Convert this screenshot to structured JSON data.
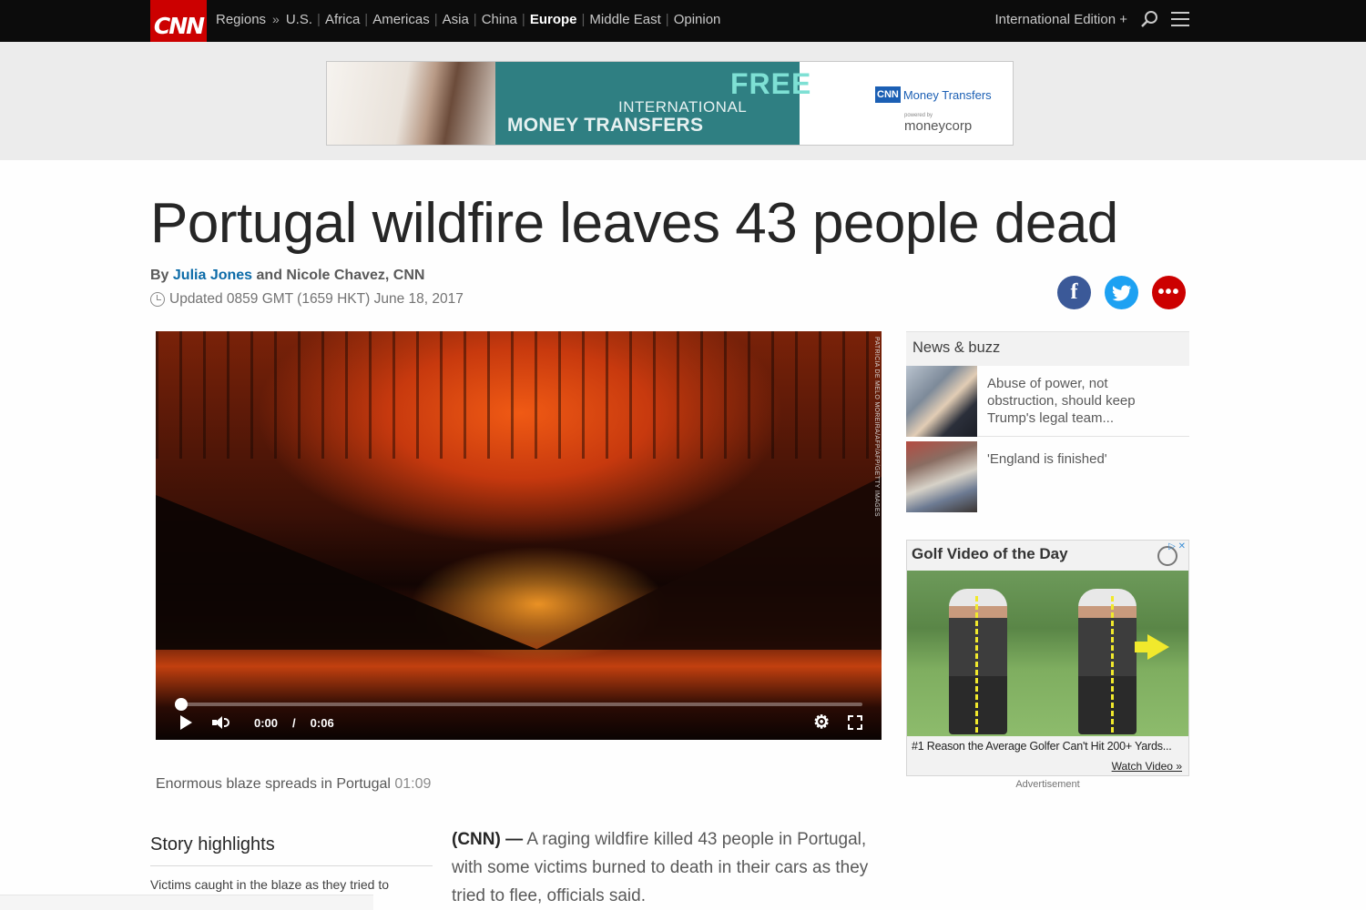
{
  "nav": {
    "logo": "CNN",
    "regions": "Regions",
    "raquo": "»",
    "items": [
      "U.S.",
      "Africa",
      "Americas",
      "Asia",
      "China",
      "Europe",
      "Middle East",
      "Opinion"
    ],
    "active": "Europe",
    "edition": "International Edition +",
    "search_icon": "search-icon",
    "menu_icon": "hamburger-menu-icon"
  },
  "banner_ad": {
    "free": "FREE",
    "international": "INTERNATIONAL",
    "money_transfers": "MONEY TRANSFERS",
    "brand_box": "CNN",
    "brand_text": "Money Transfers",
    "powered": "powered by",
    "partner": "moneycorp"
  },
  "article": {
    "headline": "Portugal wildfire leaves 43 people dead",
    "by": "By",
    "author_link": "Julia Jones",
    "coauthors": "and Nicole Chavez, CNN",
    "updated": "Updated 0859 GMT (1659 HKT) June 18, 2017",
    "share": {
      "facebook": "f",
      "twitter": "t",
      "more": "•••"
    }
  },
  "video": {
    "credit": "PATRICIA DE MELO MOREIRA/AFP/AFP/GETTY IMAGES",
    "current_time": "0:00",
    "separator": "/",
    "duration": "0:06",
    "progress": 0,
    "caption": "Enormous blaze spreads in Portugal",
    "caption_duration": "01:09"
  },
  "highlights": {
    "title": "Story highlights",
    "items": [
      "Victims caught in the blaze as they tried to"
    ]
  },
  "body": {
    "dateline": "(CNN) —",
    "text": " A raging wildfire killed 43 people in Portugal, with some victims burned to death in their cars as they tried to flee, officials said."
  },
  "sidebar": {
    "news_buzz_title": "News & buzz",
    "items": [
      {
        "text": "Abuse of power, not obstruction, should keep Trump's legal team..."
      },
      {
        "text": "'England is finished'"
      }
    ],
    "golf_ad": {
      "title": "Golf Video of the Day",
      "ad_choices": "▷ ✕",
      "reason": "#1 Reason the Average Golfer Can't Hit 200+ Yards...",
      "watch": "Watch Video »"
    },
    "ad_label": "Advertisement"
  },
  "colors": {
    "cnn_red": "#cc0000",
    "nav_bg": "#0c0c0c",
    "link_blue": "#0c6ba8",
    "facebook": "#3b5998",
    "twitter": "#1da1f2"
  }
}
